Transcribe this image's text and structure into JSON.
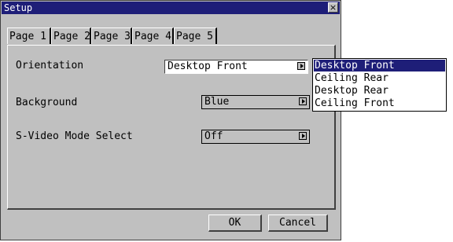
{
  "window": {
    "title": "Setup",
    "close_glyph": "×"
  },
  "tabs": [
    {
      "label": "Page 1"
    },
    {
      "label": "Page 2"
    },
    {
      "label": "Page 3"
    },
    {
      "label": "Page 4"
    },
    {
      "label": "Page 5"
    }
  ],
  "settings": {
    "orientation": {
      "label": "Orientation",
      "value": "Desktop Front"
    },
    "background": {
      "label": "Background",
      "value": "Blue"
    },
    "svideo": {
      "label": "S-Video Mode Select",
      "value": "Off"
    }
  },
  "orientation_options": [
    "Desktop Front",
    "Ceiling Rear",
    "Desktop Rear",
    "Ceiling Front"
  ],
  "buttons": {
    "ok": "OK",
    "cancel": "Cancel"
  },
  "colors": {
    "titlebar": "#1e1e78",
    "face": "#c0c0c0",
    "selection": "#1e1e78"
  }
}
